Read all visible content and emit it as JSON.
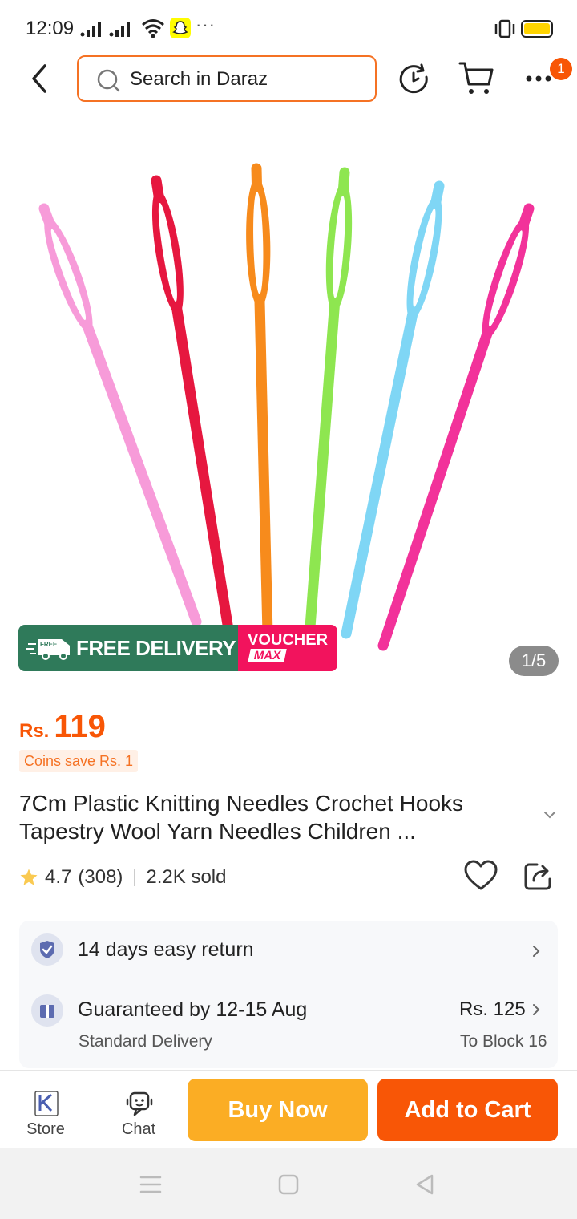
{
  "status_bar": {
    "time": "12:09",
    "more": "···"
  },
  "header": {
    "search_placeholder": "Search in Daraz",
    "cart_badge": "1"
  },
  "product": {
    "image_counter": "1/5",
    "promo": {
      "free_delivery": "FREE DELIVERY",
      "free_tag": "FREE",
      "voucher_top": "VOUCHER",
      "voucher_max": "MAX"
    },
    "price_currency": "Rs.",
    "price_value": "119",
    "coins_text": "Coins save Rs. 1",
    "title": "7Cm Plastic Knitting Needles Crochet Hooks Tapestry Wool Yarn Needles Children ...",
    "rating": "4.7",
    "reviews": "(308)",
    "sold": "2.2K sold",
    "needle_colors": [
      "#f79bd9",
      "#e6173f",
      "#f78b1c",
      "#8ee650",
      "#7fd6f5",
      "#f2329a"
    ]
  },
  "services": {
    "return_text": "14 days easy return",
    "delivery_text": "Guaranteed by 12-15 Aug",
    "delivery_type": "Standard Delivery",
    "delivery_price": "Rs. 125",
    "delivery_dest": "To Block 16"
  },
  "actions": {
    "store_label": "Store",
    "chat_label": "Chat",
    "buy_now": "Buy Now",
    "add_to_cart": "Add to Cart"
  },
  "colors": {
    "accent": "#f85606",
    "buy_now": "#fbad24",
    "free_delivery_bg": "#2f7a5a",
    "voucher_bg": "#f2135d"
  }
}
